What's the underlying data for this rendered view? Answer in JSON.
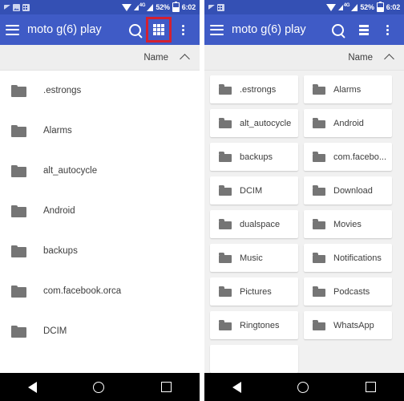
{
  "status_bar": {
    "network_label": "4G",
    "battery_percent": "52%",
    "time": "6:02",
    "icons": [
      "notification-icon",
      "screenshot-icon",
      "calendar-icon",
      "wifi-icon",
      "signal-icon",
      "battery-icon"
    ]
  },
  "app_bar": {
    "title": "moto g(6) play",
    "menu_icon": "hamburger-menu-icon",
    "search_icon": "search-icon",
    "overflow_icon": "more-options-icon",
    "left_view_toggle_icon": "grid-view-icon",
    "right_view_toggle_icon": "list-view-icon",
    "highlight_color": "#d42030"
  },
  "sort_bar": {
    "label": "Name",
    "direction_icon": "chevron-up-icon"
  },
  "colors": {
    "app_bar_blue": "#3f5bc6",
    "status_bar_blue": "#3450b4",
    "folder_gray": "#757575",
    "background_gray": "#f1f1f1",
    "sort_bar_gray": "#eeeeee",
    "highlight_red": "#d42030",
    "nav_bar_black": "#000000"
  },
  "left_panel": {
    "view_mode": "list",
    "items": [
      {
        "name": ".estrongs"
      },
      {
        "name": "Alarms"
      },
      {
        "name": "alt_autocycle"
      },
      {
        "name": "Android"
      },
      {
        "name": "backups"
      },
      {
        "name": "com.facebook.orca"
      },
      {
        "name": "DCIM"
      }
    ]
  },
  "right_panel": {
    "view_mode": "grid",
    "items": [
      {
        "name": ".estrongs"
      },
      {
        "name": "Alarms"
      },
      {
        "name": "alt_autocycle"
      },
      {
        "name": "Android"
      },
      {
        "name": "backups"
      },
      {
        "name": "com.facebo..."
      },
      {
        "name": "DCIM"
      },
      {
        "name": "Download"
      },
      {
        "name": "dualspace"
      },
      {
        "name": "Movies"
      },
      {
        "name": "Music"
      },
      {
        "name": "Notifications"
      },
      {
        "name": "Pictures"
      },
      {
        "name": "Podcasts"
      },
      {
        "name": "Ringtones"
      },
      {
        "name": "WhatsApp"
      },
      {
        "name": ""
      }
    ]
  },
  "nav_bar": {
    "back_icon": "back-triangle-icon",
    "home_icon": "home-circle-icon",
    "recents_icon": "recents-square-icon"
  }
}
